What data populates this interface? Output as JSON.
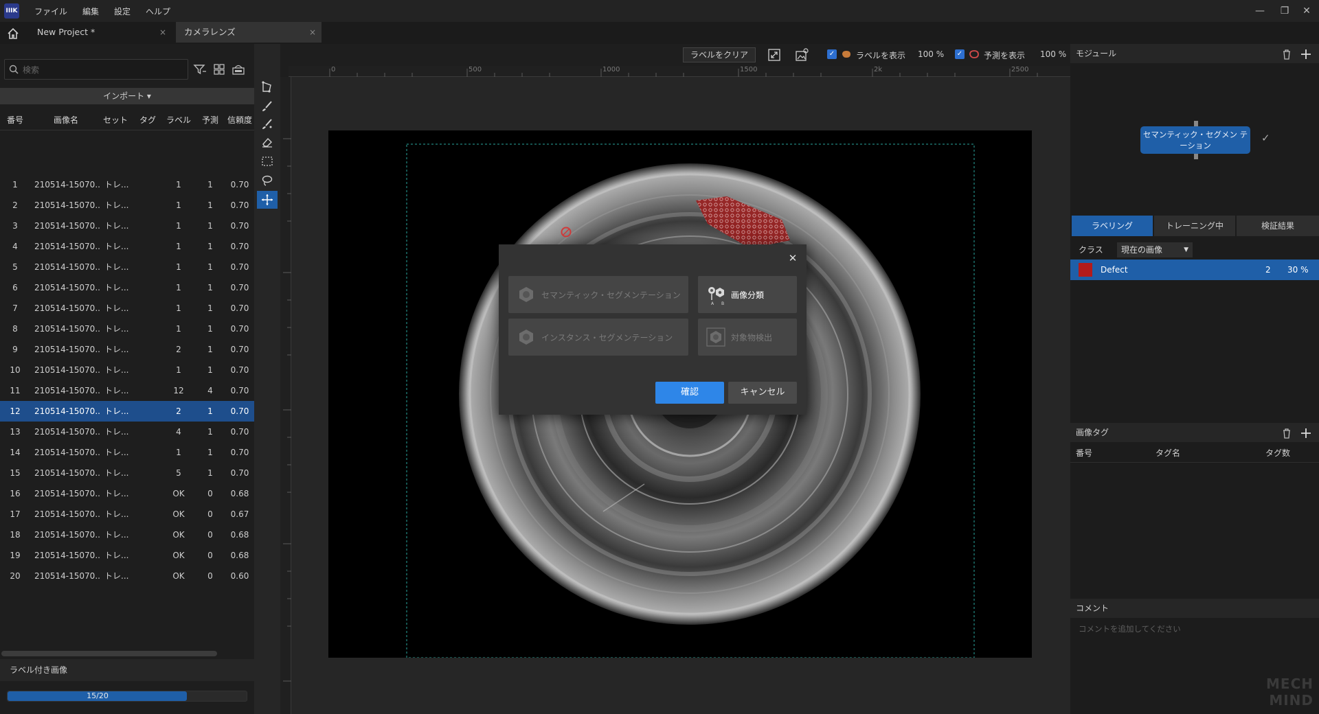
{
  "app": {
    "logo_text": "IIIK",
    "menu": [
      "ファイル",
      "編集",
      "設定",
      "ヘルプ"
    ],
    "window_controls": [
      "—",
      "❐",
      "✕"
    ]
  },
  "tabs": [
    {
      "label": "New Project *",
      "active": false
    },
    {
      "label": "カメラレンズ",
      "active": true
    }
  ],
  "left_panel": {
    "search_placeholder": "検索",
    "import_label": "インポート ▾",
    "columns": [
      "番号",
      "画像名",
      "セット",
      "タグ",
      "ラベル",
      "予測",
      "信頼度"
    ],
    "rows": [
      {
        "no": "1",
        "name": "210514-15070...",
        "set": "トレ...",
        "tag": "",
        "label": "1",
        "pred": "1",
        "conf": "0.70"
      },
      {
        "no": "2",
        "name": "210514-15070...",
        "set": "トレ...",
        "tag": "",
        "label": "1",
        "pred": "1",
        "conf": "0.70"
      },
      {
        "no": "3",
        "name": "210514-15070...",
        "set": "トレ...",
        "tag": "",
        "label": "1",
        "pred": "1",
        "conf": "0.70"
      },
      {
        "no": "4",
        "name": "210514-15070...",
        "set": "トレ...",
        "tag": "",
        "label": "1",
        "pred": "1",
        "conf": "0.70"
      },
      {
        "no": "5",
        "name": "210514-15070...",
        "set": "トレ...",
        "tag": "",
        "label": "1",
        "pred": "1",
        "conf": "0.70"
      },
      {
        "no": "6",
        "name": "210514-15070...",
        "set": "トレ...",
        "tag": "",
        "label": "1",
        "pred": "1",
        "conf": "0.70"
      },
      {
        "no": "7",
        "name": "210514-15070...",
        "set": "トレ...",
        "tag": "",
        "label": "1",
        "pred": "1",
        "conf": "0.70"
      },
      {
        "no": "8",
        "name": "210514-15070...",
        "set": "トレ...",
        "tag": "",
        "label": "1",
        "pred": "1",
        "conf": "0.70"
      },
      {
        "no": "9",
        "name": "210514-15070...",
        "set": "トレ...",
        "tag": "",
        "label": "2",
        "pred": "1",
        "conf": "0.70"
      },
      {
        "no": "10",
        "name": "210514-15070...",
        "set": "トレ...",
        "tag": "",
        "label": "1",
        "pred": "1",
        "conf": "0.70"
      },
      {
        "no": "11",
        "name": "210514-15070...",
        "set": "トレ...",
        "tag": "",
        "label": "12",
        "pred": "4",
        "conf": "0.70"
      },
      {
        "no": "12",
        "name": "210514-15070...",
        "set": "トレ...",
        "tag": "",
        "label": "2",
        "pred": "1",
        "conf": "0.70",
        "selected": true
      },
      {
        "no": "13",
        "name": "210514-15070...",
        "set": "トレ...",
        "tag": "",
        "label": "4",
        "pred": "1",
        "conf": "0.70"
      },
      {
        "no": "14",
        "name": "210514-15070...",
        "set": "トレ...",
        "tag": "",
        "label": "1",
        "pred": "1",
        "conf": "0.70"
      },
      {
        "no": "15",
        "name": "210514-15070...",
        "set": "トレ...",
        "tag": "",
        "label": "5",
        "pred": "1",
        "conf": "0.70"
      },
      {
        "no": "16",
        "name": "210514-15070...",
        "set": "トレ...",
        "tag": "",
        "label": "OK",
        "pred": "0",
        "conf": "0.68"
      },
      {
        "no": "17",
        "name": "210514-15070...",
        "set": "トレ...",
        "tag": "",
        "label": "OK",
        "pred": "0",
        "conf": "0.67"
      },
      {
        "no": "18",
        "name": "210514-15070...",
        "set": "トレ...",
        "tag": "",
        "label": "OK",
        "pred": "0",
        "conf": "0.68"
      },
      {
        "no": "19",
        "name": "210514-15070...",
        "set": "トレ...",
        "tag": "",
        "label": "OK",
        "pred": "0",
        "conf": "0.68"
      },
      {
        "no": "20",
        "name": "210514-15070...",
        "set": "トレ...",
        "tag": "",
        "label": "OK",
        "pred": "0",
        "conf": "0.60"
      }
    ],
    "labeled_header": "ラベル付き画像",
    "progress_text": "15/20",
    "progress_fraction": 0.75
  },
  "viewer": {
    "clear_label": "ラベルをクリア",
    "show_label": "ラベルを表示",
    "label_opacity": "100 %",
    "show_prediction": "予測を表示",
    "prediction_opacity": "100 %",
    "ruler_ticks": [
      "0",
      "500",
      "1000",
      "1500",
      "2k",
      "2500"
    ]
  },
  "dialog": {
    "options": [
      {
        "label": "セマンティック・セグメンテーション",
        "enabled": false
      },
      {
        "label": "画像分類",
        "enabled": true
      },
      {
        "label": "インスタンス・セグメンテーション",
        "enabled": false
      },
      {
        "label": "対象物検出",
        "enabled": false
      }
    ],
    "confirm": "確認",
    "cancel": "キャンセル",
    "close_glyph": "✕"
  },
  "right_panel": {
    "module_header": "モジュール",
    "module_node": "セマンティック・セグメン テーション",
    "check_glyph": "✓",
    "tabs": [
      "ラベリング",
      "トレーニング中",
      "検証結果"
    ],
    "class_label": "クラス",
    "class_select": "現在の画像",
    "classes": [
      {
        "name": "Defect",
        "count": "2",
        "percent": "30 %",
        "color": "#b31b1b"
      }
    ],
    "image_tag_header": "画像タグ",
    "tag_columns": [
      "番号",
      "タグ名",
      "タグ数"
    ],
    "comment_header": "コメント",
    "comment_placeholder": "コメントを追加してください",
    "watermark": "MECH MIND"
  },
  "colors": {
    "accent": "#1f5fa8",
    "confirm": "#2e86e8",
    "defect": "#b31b1b"
  }
}
